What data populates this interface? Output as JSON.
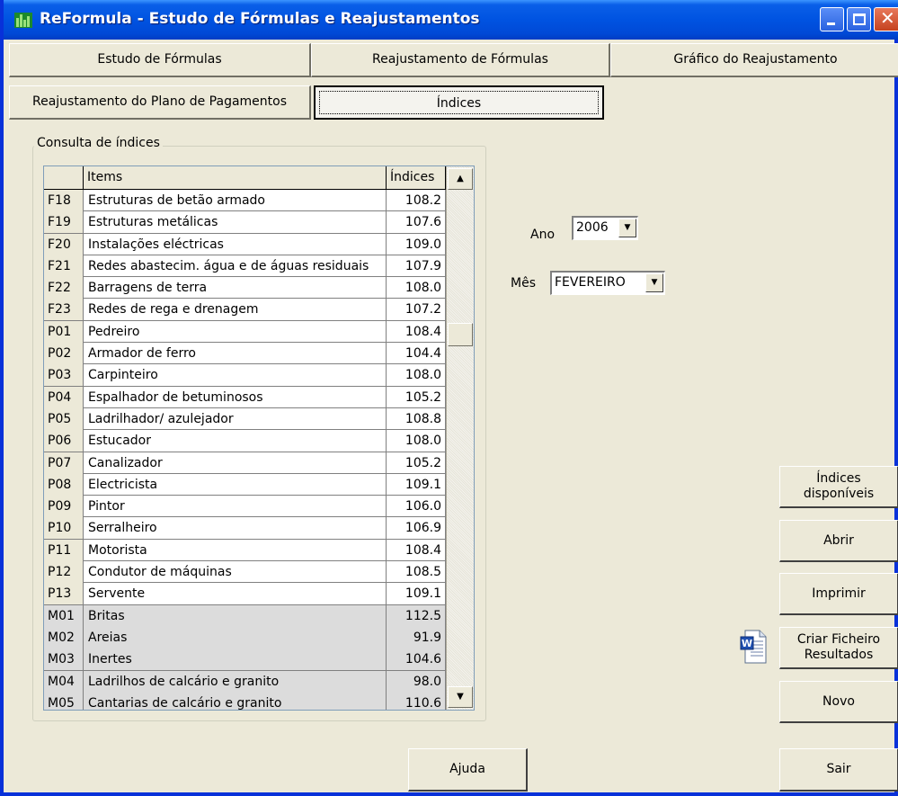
{
  "window": {
    "title": "ReFormula - Estudo de Fórmulas e Reajustamentos"
  },
  "tabs": [
    {
      "label": "Estudo de Fórmulas"
    },
    {
      "label": "Reajustamento de Fórmulas"
    },
    {
      "label": "Gráfico do Reajustamento"
    },
    {
      "label": "Reajustamento do Plano de Pagamentos"
    },
    {
      "label": "Índices"
    }
  ],
  "group": {
    "label": "Consulta de índices"
  },
  "grid": {
    "headers": {
      "code": "",
      "items": "Items",
      "values": "Índices"
    },
    "rows": [
      {
        "code": "F18",
        "item": "Estruturas de betão armado",
        "value": "108.2"
      },
      {
        "code": "F19",
        "item": "Estruturas metálicas",
        "value": "107.6"
      },
      {
        "code": "F20",
        "item": "Instalações eléctricas",
        "value": "109.0"
      },
      {
        "code": "F21",
        "item": "Redes abastecim. água e de águas residuais",
        "value": "107.9"
      },
      {
        "code": "F22",
        "item": "Barragens de terra",
        "value": "108.0"
      },
      {
        "code": "F23",
        "item": "Redes de rega e drenagem",
        "value": "107.2"
      },
      {
        "code": "P01",
        "item": "Pedreiro",
        "value": "108.4"
      },
      {
        "code": "P02",
        "item": "Armador de ferro",
        "value": "104.4"
      },
      {
        "code": "P03",
        "item": "Carpinteiro",
        "value": "108.0"
      },
      {
        "code": "P04",
        "item": "Espalhador de betuminosos",
        "value": "105.2"
      },
      {
        "code": "P05",
        "item": "Ladrilhador/ azulejador",
        "value": "108.8"
      },
      {
        "code": "P06",
        "item": "Estucador",
        "value": "108.0"
      },
      {
        "code": "P07",
        "item": "Canalizador",
        "value": "105.2"
      },
      {
        "code": "P08",
        "item": "Electricista",
        "value": "109.1"
      },
      {
        "code": "P09",
        "item": "Pintor",
        "value": "106.0"
      },
      {
        "code": "P10",
        "item": "Serralheiro",
        "value": "106.9"
      },
      {
        "code": "P11",
        "item": "Motorista",
        "value": "108.4"
      },
      {
        "code": "P12",
        "item": "Condutor de máquinas",
        "value": "108.5"
      },
      {
        "code": "P13",
        "item": "Servente",
        "value": "109.1"
      },
      {
        "code": "M01",
        "item": "Britas",
        "value": "112.5"
      },
      {
        "code": "M02",
        "item": "Areias",
        "value": "91.9"
      },
      {
        "code": "M03",
        "item": "Inertes",
        "value": "104.6"
      },
      {
        "code": "M04",
        "item": "Ladrilhos de calcário e granito",
        "value": "98.0"
      },
      {
        "code": "M05",
        "item": "Cantarias de calcário e granito",
        "value": "110.6"
      }
    ]
  },
  "filters": {
    "ano_label": "Ano",
    "ano_value": "2006",
    "mes_label": "Mês",
    "mes_value": "FEVEREIRO"
  },
  "buttons": {
    "indices_line1": "Índices",
    "indices_line2": "disponíveis",
    "abrir": "Abrir",
    "imprimir": "Imprimir",
    "criar_line1": "Criar Ficheiro",
    "criar_line2": "Resultados",
    "novo": "Novo",
    "ajuda": "Ajuda",
    "sair": "Sair"
  },
  "icons": {
    "app": "bar-chart-icon",
    "word_doc": "word-document-icon"
  },
  "colors": {
    "titlebar": "#0053e1",
    "window_bg": "#ece9d8",
    "material_rows": "#dcdcdc"
  }
}
